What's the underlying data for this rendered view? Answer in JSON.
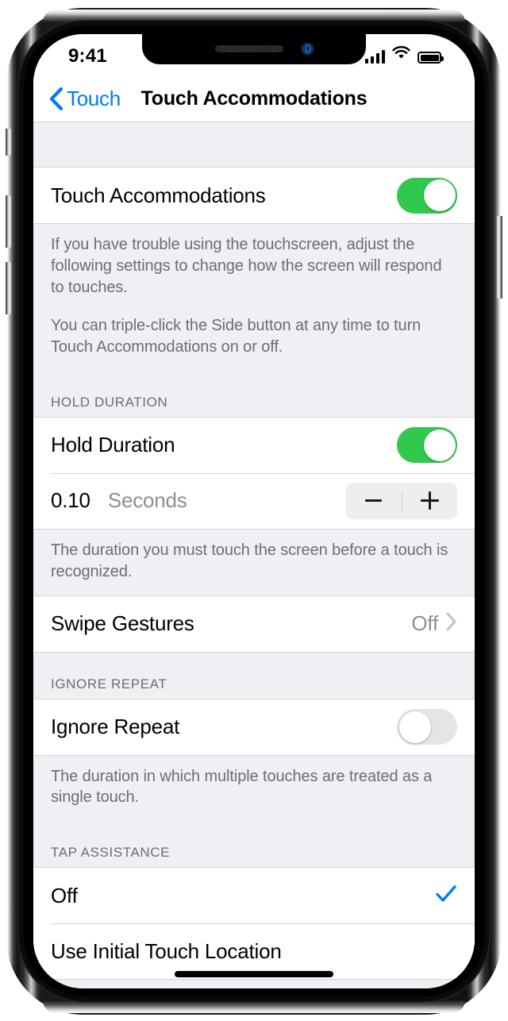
{
  "status_bar": {
    "time": "9:41",
    "signal_icon": "cellular-bars-icon",
    "wifi_icon": "wifi-icon",
    "battery_icon": "battery-full-icon"
  },
  "nav": {
    "back_label": "Touch",
    "title": "Touch Accommodations"
  },
  "colors": {
    "accent_blue": "#007AFF",
    "toggle_on_green": "#30C94E",
    "toggle_off_gray": "#E5E5E7",
    "group_background": "#EFEFF4",
    "secondary_text": "#6D6D72",
    "value_text": "#8E8E93"
  },
  "sections": {
    "main": {
      "toggle_row": {
        "label": "Touch Accommodations",
        "state": "on"
      },
      "footer_paragraph_1": "If you have trouble using the touchscreen, adjust the following settings to change how the screen will respond to touches.",
      "footer_paragraph_2": "You can triple-click the Side button at any time to turn Touch Accommodations on or off."
    },
    "hold_duration": {
      "header": "HOLD DURATION",
      "toggle_row": {
        "label": "Hold Duration",
        "state": "on"
      },
      "stepper_row": {
        "value": "0.10",
        "unit": "Seconds",
        "decrement_label": "Decrease",
        "increment_label": "Increase"
      },
      "footer": "The duration you must touch the screen before a touch is recognized.",
      "swipe_gestures": {
        "label": "Swipe Gestures",
        "value": "Off"
      }
    },
    "ignore_repeat": {
      "header": "IGNORE REPEAT",
      "toggle_row": {
        "label": "Ignore Repeat",
        "state": "off"
      },
      "footer": "The duration in which multiple touches are treated as a single touch."
    },
    "tap_assistance": {
      "header": "TAP ASSISTANCE",
      "options": [
        {
          "label": "Off",
          "selected": true
        },
        {
          "label": "Use Initial Touch Location",
          "selected": false
        }
      ]
    }
  }
}
